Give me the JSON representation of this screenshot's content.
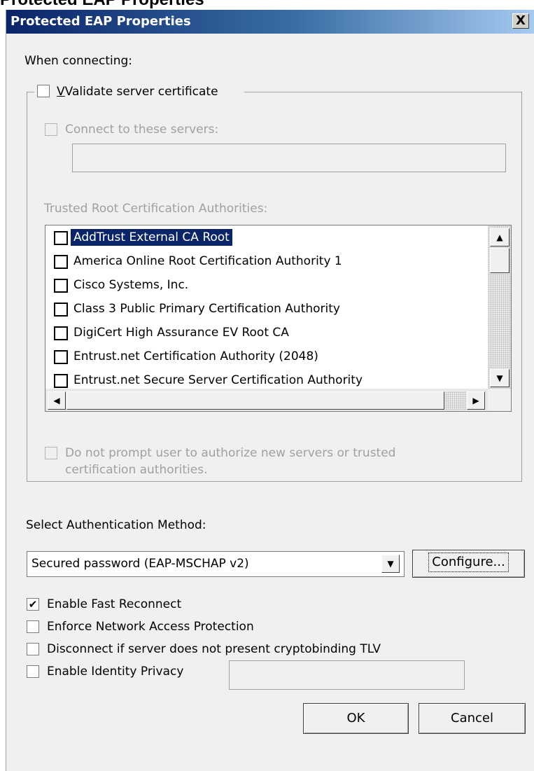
{
  "clipped_heading": "Protected EAP Properties",
  "window": {
    "title": "Protected EAP Properties",
    "close_label": "X"
  },
  "when_connecting_label": "When connecting:",
  "validate_cert": {
    "label": "Validate server certificate",
    "checked": false
  },
  "connect_servers": {
    "label": "Connect to these servers:",
    "checked": false,
    "value": ""
  },
  "trusted_root": {
    "label": "Trusted Root Certification Authorities:",
    "items": [
      {
        "label": "AddTrust External CA Root",
        "checked": false,
        "selected": true
      },
      {
        "label": "America Online Root Certification Authority 1",
        "checked": false
      },
      {
        "label": "Cisco Systems, Inc.",
        "checked": false
      },
      {
        "label": "Class 3 Public Primary Certification Authority",
        "checked": false
      },
      {
        "label": "DigiCert High Assurance EV Root CA",
        "checked": false
      },
      {
        "label": "Entrust.net Certification Authority (2048)",
        "checked": false
      },
      {
        "label": "Entrust.net Secure Server Certification Authority",
        "checked": false
      }
    ]
  },
  "do_not_prompt": {
    "line1": "Do not prompt user to authorize new servers or trusted",
    "line2": "certification authorities.",
    "checked": false
  },
  "auth_method": {
    "label": "Select Authentication Method:",
    "selected": "Secured password (EAP-MSCHAP v2)",
    "configure_label": "Configure..."
  },
  "options": [
    {
      "label": "Enable Fast Reconnect",
      "checked": true
    },
    {
      "label": "Enforce Network Access Protection",
      "checked": false
    },
    {
      "label": "Disconnect if server does not present cryptobinding TLV",
      "checked": false
    },
    {
      "label": "Enable Identity Privacy",
      "checked": false
    }
  ],
  "identity_privacy_value": "",
  "buttons": {
    "ok": "OK",
    "cancel": "Cancel"
  }
}
